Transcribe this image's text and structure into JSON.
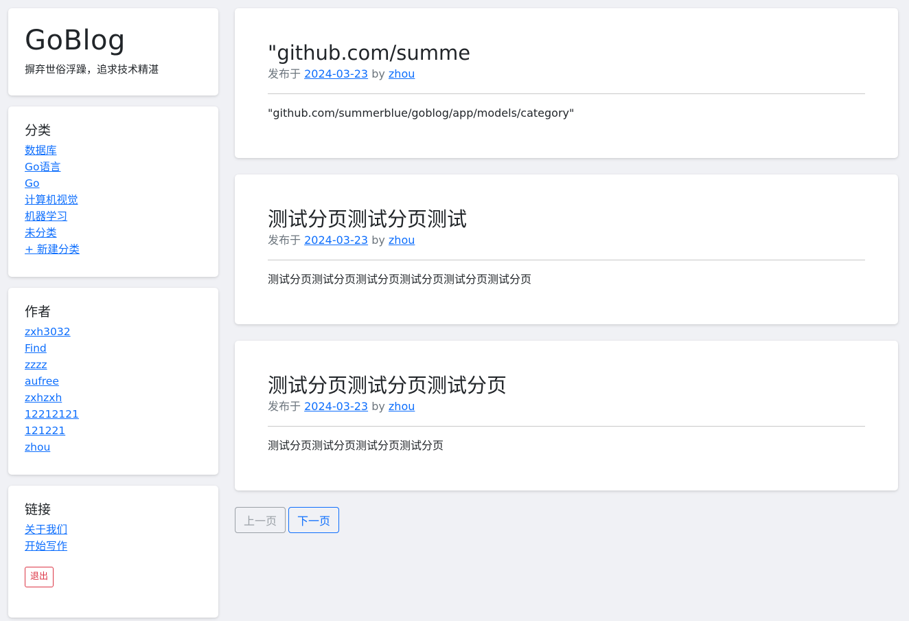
{
  "brand": {
    "title": "GoBlog",
    "tagline": "摒弃世俗浮躁，追求技术精湛"
  },
  "categories": {
    "title": "分类",
    "items": [
      "数据库",
      "Go语言",
      "Go",
      "计算机视觉",
      "机器学习",
      "未分类",
      "+ 新建分类"
    ]
  },
  "authors": {
    "title": "作者",
    "items": [
      "zxh3032",
      "Find",
      "zzzz",
      "aufree",
      "zxhzxh",
      "12212121",
      "121221",
      "zhou"
    ]
  },
  "links": {
    "title": "链接",
    "items": [
      "关于我们",
      "开始写作"
    ],
    "logout_label": "退出"
  },
  "posts": [
    {
      "title": "\"github.com/summe",
      "meta_prefix": "发布于",
      "date": "2024-03-23",
      "by": "by",
      "author": "zhou",
      "excerpt": "\"github.com/summerblue/goblog/app/models/category\""
    },
    {
      "title": "测试分页测试分页测试",
      "meta_prefix": "发布于",
      "date": "2024-03-23",
      "by": "by",
      "author": "zhou",
      "excerpt": "测试分页测试分页测试分页测试分页测试分页测试分页"
    },
    {
      "title": "测试分页测试分页测试分页",
      "meta_prefix": "发布于",
      "date": "2024-03-23",
      "by": "by",
      "author": "zhou",
      "excerpt": "测试分页测试分页测试分页测试分页"
    }
  ],
  "pagination": {
    "prev_label": "上一页",
    "next_label": "下一页"
  },
  "colors": {
    "background": "#f0f1f5",
    "link": "#0d6efd",
    "danger": "#dc3545",
    "muted": "#6c757d"
  }
}
